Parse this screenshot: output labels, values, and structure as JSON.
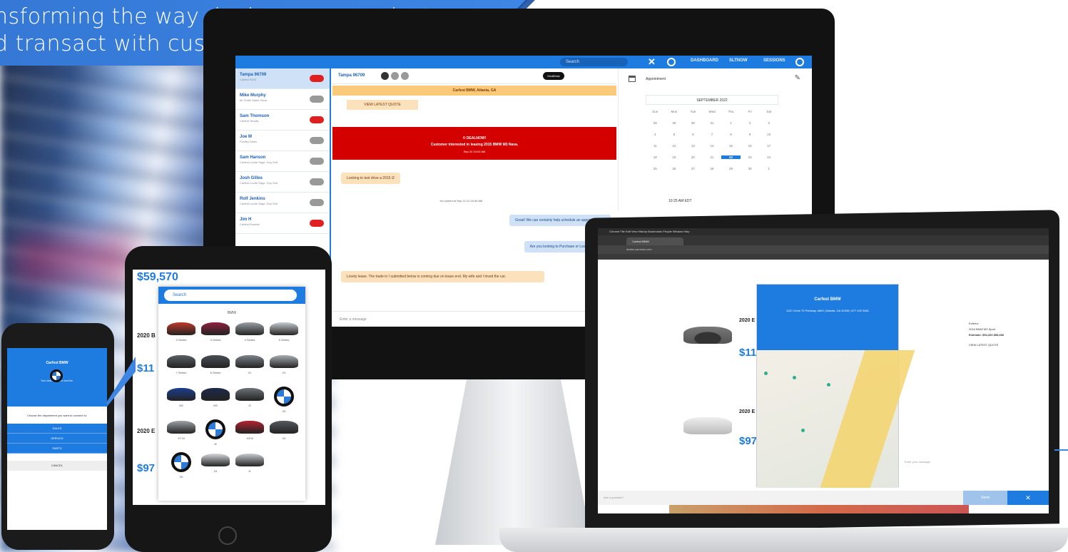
{
  "banner": {
    "line1": "nsforming the way dealers communicate",
    "line2": "d transact with customers"
  },
  "monitor": {
    "search": "Search",
    "nav": [
      "DASHBOARD",
      "SLTNOW",
      "SESSIONS"
    ],
    "conversations": [
      {
        "name": "Tampa 96709",
        "sub": "Carfest 9693",
        "badge_color": "red",
        "active": true
      },
      {
        "name": "Mike Murphy",
        "sub": "Mr Smith Sales Show",
        "badge_color": "grey"
      },
      {
        "name": "Sam Thomson",
        "sub": "Carfest Tenally",
        "badge_color": "red"
      },
      {
        "name": "Joe M",
        "sub": "Findley Sales",
        "badge_color": "grey"
      },
      {
        "name": "Sam Hanson",
        "sub": "Carfest Lunde Sage, Sep Selt",
        "badge_color": "grey"
      },
      {
        "name": "Josh Gilles",
        "sub": "Carfest Lunde Sage, Sep Selt",
        "badge_color": "grey"
      },
      {
        "name": "Rolf Jenkins",
        "sub": "Carfest Lunde Sage, Sep Selt",
        "badge_color": "grey"
      },
      {
        "name": "Jim H",
        "sub": "Carfest Rosetia",
        "badge_color": "red"
      }
    ],
    "chat": {
      "header_name": "Tampa 96709",
      "deal_button": "DealDesk",
      "location": "Carfest BMW, Atlanta, GA",
      "quote_button": "VIEW LATEST QUOTE",
      "alert_line1": "© DEALNOW!",
      "alert_line2": "Customer interested in leasing 2015 BMW M3 Nava.",
      "alert_time": "Sep 22 10:02 AM",
      "msg1": "Looking to test drive a 2015 i3",
      "system_note": "You joined at Sep 22 12:18:46 AM",
      "msg2": "Great! We can certainly help schedule an appointment fo",
      "msg3": "Are you looking to Purchase or Lease your next",
      "msg4": "Lovely lease. The trade in I submitted below is coming due on lease end. My wife and I loved the car.",
      "input_placeholder": "Enter a message"
    },
    "calendar": {
      "title": "Appointment",
      "month": "SEPTEMBER 2022",
      "weekdays": [
        "Sun",
        "Mon",
        "Tue",
        "Wed",
        "Thu",
        "Fri",
        "Sat"
      ],
      "days": [
        "28",
        "29",
        "30",
        "31",
        "1",
        "2",
        "3",
        "4",
        "5",
        "6",
        "7",
        "8",
        "9",
        "10",
        "11",
        "12",
        "13",
        "14",
        "15",
        "16",
        "17",
        "18",
        "19",
        "20",
        "21",
        "22",
        "23",
        "24",
        "25",
        "26",
        "27",
        "28",
        "29",
        "30",
        "1"
      ],
      "selected_day": "22",
      "time": "10:25 AM EDT"
    }
  },
  "laptop": {
    "menubar": "Chrome  File  Edit  View  History  Bookmarks  People  Window  Help",
    "tab": "Carfest BMW",
    "address": "dealer.carnews.com",
    "car1_title": "2020 E",
    "car1_price": "$11",
    "car2_title": "2020 E",
    "car2_price": "$97",
    "map_title": "Carfest BMW",
    "map_addr": "1120 Circle 75 Parkway, #800 | Atlanta, GA 30339 | 877 492 5481",
    "info_lines": [
      "Exterior",
      "2016 BMW M3 Sport",
      "Estimate: $54,260 $58,666",
      "VIEW LATEST QUOTE"
    ],
    "message_placeholder": "Enter your message",
    "ask_placeholder": "Ask a question?",
    "send_label": "Send",
    "close_label": "✕"
  },
  "tablet": {
    "price": "$59,570",
    "search_placeholder": "Search",
    "brand_label": "BMW",
    "cars": [
      "2 Series",
      "3 Series",
      "4 Series",
      "5 Series",
      "7 Series",
      "8 Series",
      "X1",
      "X2",
      "M2",
      "M3",
      "i3",
      "X5",
      "X7 M",
      "i8",
      "X3 M",
      "X4",
      "X6",
      "Z4",
      "i4"
    ],
    "side_title1": "2020 B",
    "side_price1": "$11",
    "side_title2": "2020 E",
    "side_price2": "$97"
  },
  "phone": {
    "header_title": "Carfest BMW",
    "header_sub": "Your chat request is now live.",
    "question": "Choose the department you want to connect to:",
    "options": [
      "SALES",
      "SERVICE",
      "PARTS"
    ],
    "cancel": "CANCEL"
  },
  "colors": {
    "brand_blue": "#1e7be0",
    "alert_red": "#d40000",
    "quote_orange": "#fbc97a"
  }
}
